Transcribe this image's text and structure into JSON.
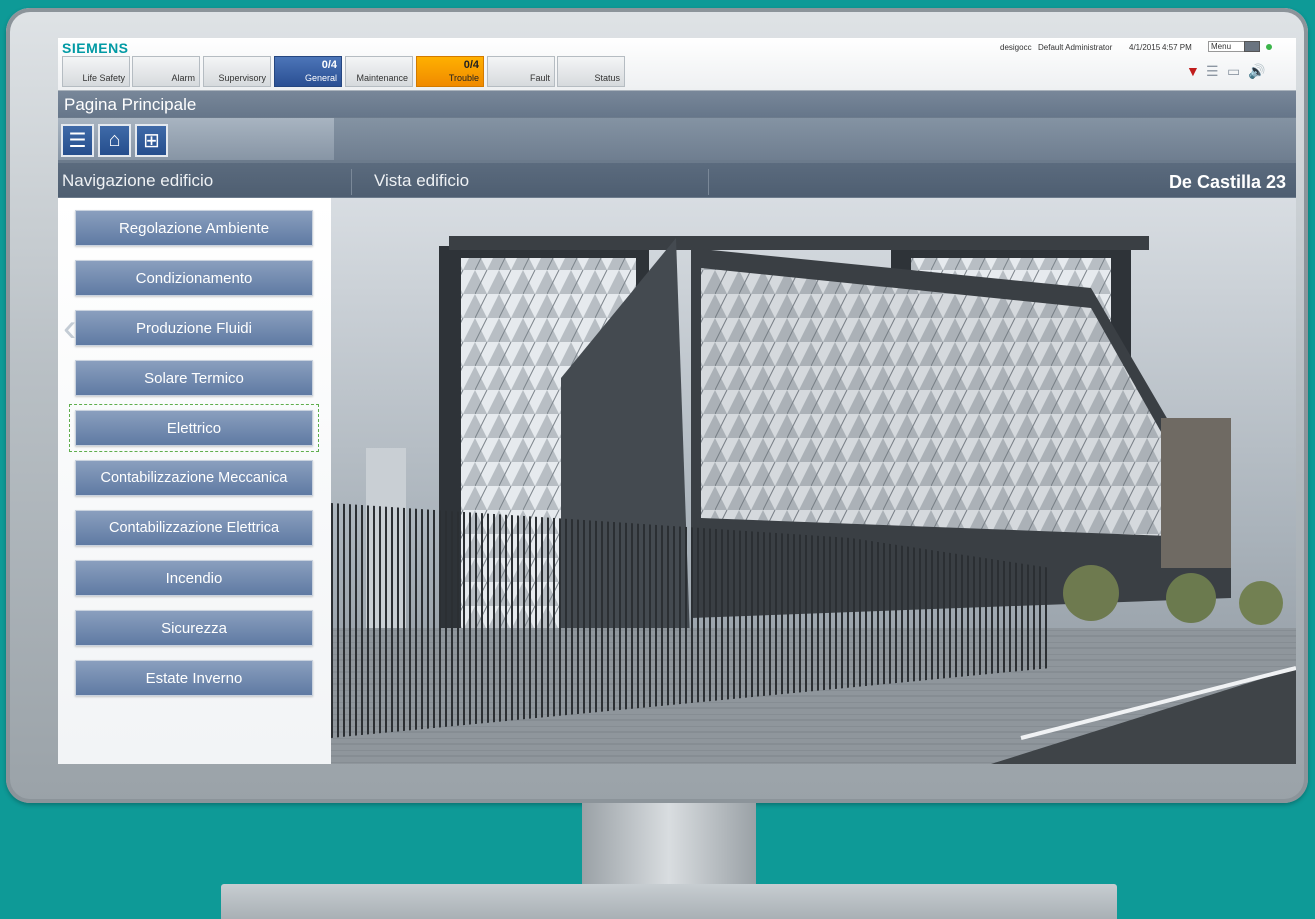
{
  "header": {
    "brand": "SIEMENS",
    "user": "desigocc",
    "role": "Default Administrator",
    "date": "4/1/2015",
    "time": "4:57 PM",
    "menu": "Menu"
  },
  "categories": [
    {
      "label": "Life Safety",
      "count": ""
    },
    {
      "label": "Alarm",
      "count": ""
    },
    {
      "label": "Supervisory",
      "count": ""
    },
    {
      "label": "General",
      "count": "0/4"
    },
    {
      "label": "Maintenance",
      "count": ""
    },
    {
      "label": "Trouble",
      "count": "0/4"
    },
    {
      "label": "Fault",
      "count": ""
    },
    {
      "label": "Status",
      "count": ""
    }
  ],
  "page": {
    "title": "Pagina Principale"
  },
  "sections": {
    "navigation": "Navigazione edificio",
    "view": "Vista edificio",
    "building": "De Castilla 23"
  },
  "nav": [
    "Regolazione Ambiente",
    "Condizionamento",
    "Produzione Fluidi",
    "Solare Termico",
    "Elettrico",
    "Contabilizzazione Meccanica",
    "Contabilizzazione Elettrica",
    "Incendio",
    "Sicurezza",
    "Estate Inverno"
  ],
  "colors": {
    "background": "#0e9a97",
    "accent": "#2a4f93",
    "trouble": "#f08a00",
    "brand": "#019aa4"
  }
}
